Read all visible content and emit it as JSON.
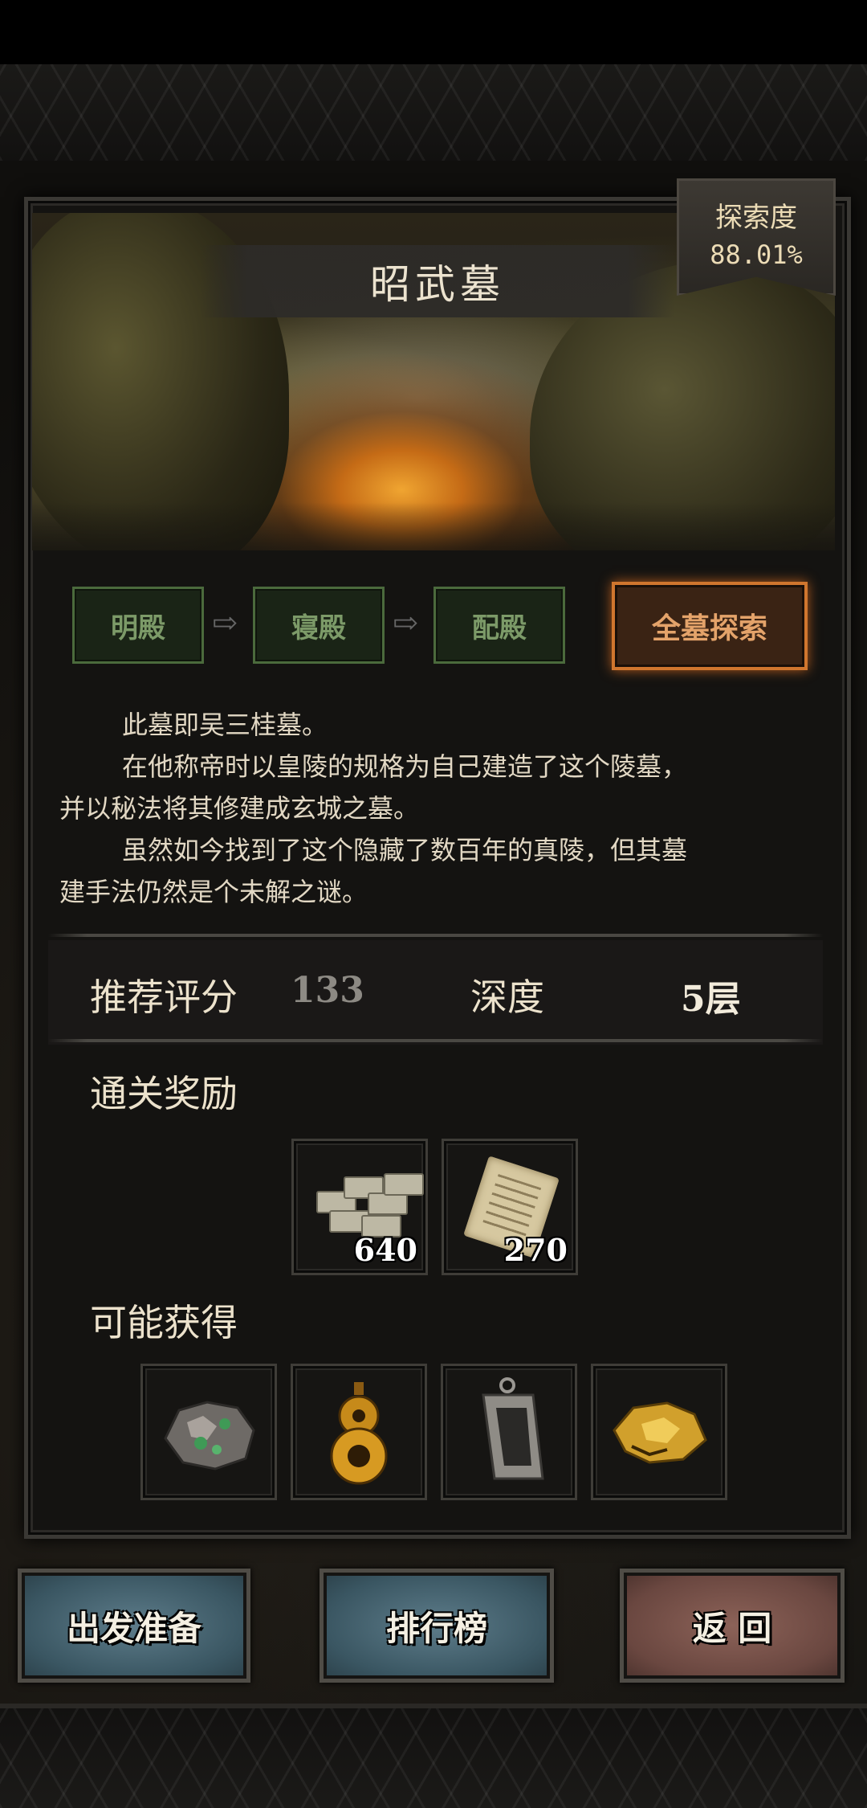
{
  "tomb": {
    "title": "昭武墓",
    "explore_label": "探索度",
    "explore_value": "88.01%"
  },
  "route": {
    "nodes": [
      "明殿",
      "寝殿",
      "配殿"
    ],
    "all_explore": "全墓探索"
  },
  "description": {
    "lines": [
      "此墓即吴三桂墓。",
      "在他称帝时以皇陵的规格为自己建造了这个陵墓，",
      "并以秘法将其修建成玄城之墓。",
      "虽然如今找到了这个隐藏了数百年的真陵，但其墓",
      "建手法仍然是个未解之谜。"
    ]
  },
  "stats": {
    "score_label": "推荐评分",
    "score_value": "133",
    "depth_label": "深度",
    "depth_value": "5层"
  },
  "rewards": {
    "label": "通关奖励",
    "items": [
      {
        "icon": "money-stack-icon",
        "count": "640"
      },
      {
        "icon": "scroll-icon",
        "count": "270"
      }
    ]
  },
  "drops": {
    "label": "可能获得",
    "items": [
      {
        "icon": "jade-ore-icon"
      },
      {
        "icon": "gold-gourd-icon"
      },
      {
        "icon": "silver-plaque-icon"
      },
      {
        "icon": "gold-nugget-icon"
      }
    ]
  },
  "buttons": {
    "prepare": "出发准备",
    "ranking": "排行榜",
    "back": "返 回"
  },
  "colors": {
    "accent_orange": "#d0762e",
    "node_green": "#4b6a3c",
    "button_blue": "#3a5662",
    "button_red": "#6a4740"
  }
}
